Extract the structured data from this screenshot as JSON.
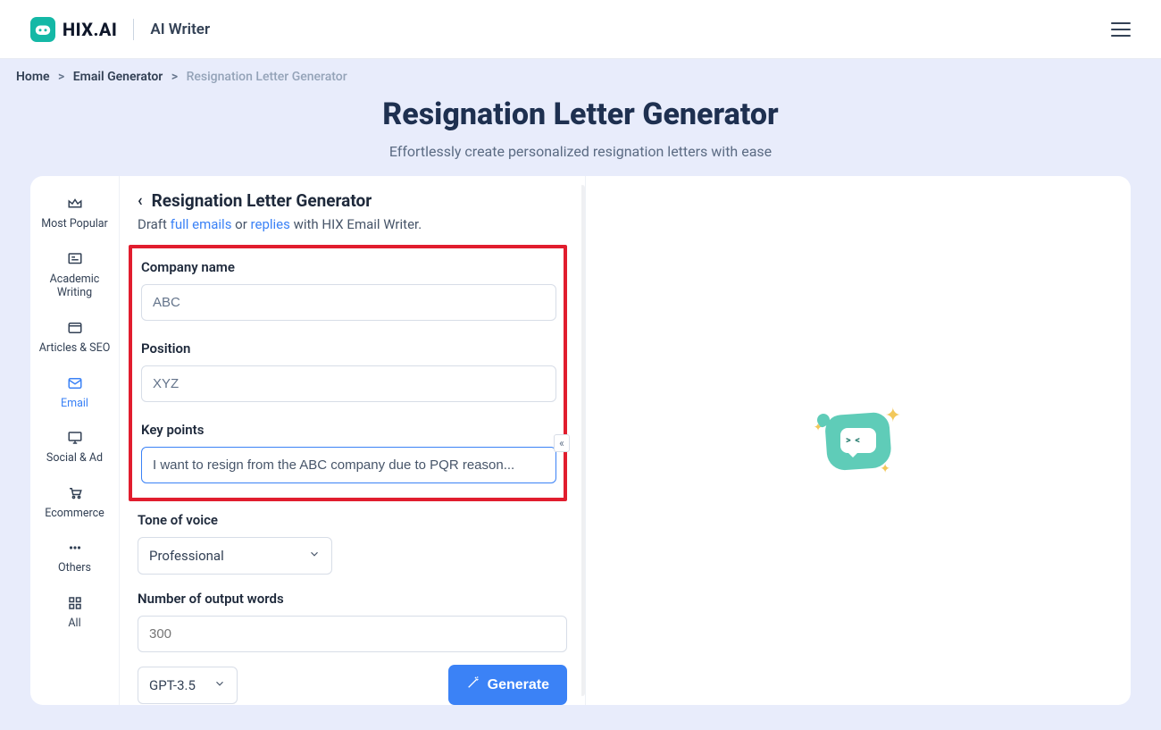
{
  "header": {
    "brand": "HIX.AI",
    "product": "AI Writer"
  },
  "breadcrumb": {
    "home": "Home",
    "email_gen": "Email Generator",
    "current": "Resignation Letter Generator"
  },
  "page": {
    "title": "Resignation Letter Generator",
    "subtitle": "Effortlessly create personalized resignation letters with ease"
  },
  "sidebar": {
    "items": [
      {
        "label": "Most Popular"
      },
      {
        "label": "Academic Writing"
      },
      {
        "label": "Articles & SEO"
      },
      {
        "label": "Email"
      },
      {
        "label": "Social & Ad"
      },
      {
        "label": "Ecommerce"
      },
      {
        "label": "Others"
      },
      {
        "label": "All"
      }
    ]
  },
  "form": {
    "panel_title": "Resignation Letter Generator",
    "desc_prefix": "Draft ",
    "desc_link1": "full emails",
    "desc_mid": " or ",
    "desc_link2": "replies",
    "desc_suffix": " with HIX Email Writer.",
    "company_label": "Company name",
    "company_value": "ABC",
    "position_label": "Position",
    "position_value": "XYZ",
    "keypoints_label": "Key points",
    "keypoints_value": "I want to resign from the ABC company due to PQR reason...",
    "tone_label": "Tone of voice",
    "tone_value": "Professional",
    "words_label": "Number of output words",
    "words_placeholder": "300",
    "model_value": "GPT-3.5",
    "generate_label": "Generate"
  }
}
